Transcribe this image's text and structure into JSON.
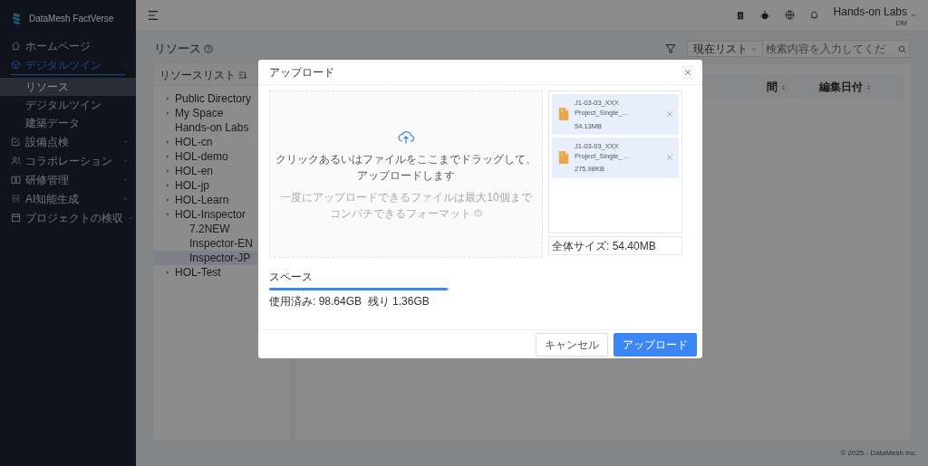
{
  "sidebar": {
    "brand": "DataMesh FactVerse",
    "items": [
      {
        "label": "ホームページ",
        "kind": "home",
        "selected": false
      },
      {
        "label": "デジタルツイン",
        "kind": "cube",
        "selected": true,
        "expanded": true,
        "children": [
          {
            "label": "リソース",
            "selected": true
          },
          {
            "label": "デジタルツイン",
            "selected": false
          },
          {
            "label": "建築データ",
            "selected": false
          }
        ]
      },
      {
        "label": "設備点検",
        "kind": "check",
        "selected": false,
        "expanded": false
      },
      {
        "label": "コラボレーション",
        "kind": "people",
        "selected": false,
        "expanded": false
      },
      {
        "label": "研修管理",
        "kind": "book",
        "selected": false,
        "expanded": false
      },
      {
        "label": "AI知能生成",
        "kind": "ai",
        "selected": false,
        "expanded": false
      },
      {
        "label": "プロジェクトの検収",
        "kind": "calendar",
        "selected": false,
        "expanded": false
      }
    ]
  },
  "header": {
    "user": "Hands-on Labs",
    "role": "DM"
  },
  "page": {
    "title": "リソース",
    "scope": "現在リスト",
    "search_placeholder": "検索内容を入力してくだ"
  },
  "tree": {
    "title": "リソースリスト",
    "items": [
      {
        "label": "Public Directory",
        "expanded": false,
        "selected": false
      },
      {
        "label": "My Space",
        "expanded": false,
        "selected": false
      },
      {
        "label": "Hands-on Labs",
        "selected": false
      },
      {
        "label": "HOL-cn",
        "expanded": false,
        "selected": false
      },
      {
        "label": "HOL-demo",
        "expanded": false,
        "selected": false
      },
      {
        "label": "HOL-en",
        "expanded": false,
        "selected": false
      },
      {
        "label": "HOL-jp",
        "expanded": false,
        "selected": false
      },
      {
        "label": "HOL-Learn",
        "expanded": false,
        "selected": false
      },
      {
        "label": "HOL-Inspector",
        "expanded": true,
        "selected": false,
        "children": [
          {
            "label": "7.2NEW",
            "selected": false
          },
          {
            "label": "Inspector-EN",
            "selected": false
          },
          {
            "label": "Inspector-JP",
            "selected": true
          }
        ]
      },
      {
        "label": "HOL-Test",
        "expanded": false,
        "selected": false
      }
    ]
  },
  "table": {
    "columns": [
      "間",
      "編集日付"
    ]
  },
  "modal": {
    "title": "アップロード",
    "drop_text": "クリックあるいはファイルをここまでドラッグして、アップロードします",
    "hints": [
      "一度にアップロードできるファイルは最大10個まで",
      "コンパチできるフォーマット"
    ],
    "files": [
      {
        "name": "J1-03-03_XXX Project_Single_...",
        "size": "54.13MB"
      },
      {
        "name": "J1-03-03_XXX Project_Single_ ...",
        "size": "275.98KB"
      }
    ],
    "total": "全体サイズ: 54.40MB",
    "space": {
      "label": "スペース",
      "level": 0.9864,
      "usage": "使用済み: 98.64GB  残り 1.36GB"
    },
    "buttons": [
      {
        "label": "キャンセル",
        "kind": "secondary"
      },
      {
        "label": "アップロード",
        "kind": "primary"
      }
    ]
  },
  "footer": "© 2025 - DataMesh Inc."
}
